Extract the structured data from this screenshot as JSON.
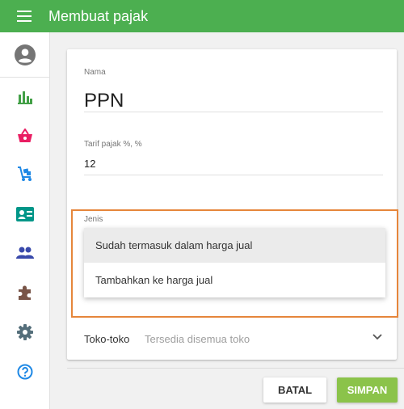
{
  "appbar": {
    "title": "Membuat pajak"
  },
  "form": {
    "name_label": "Nama",
    "name_value": "PPN",
    "rate_label": "Tarif pajak %, %",
    "rate_value": "12",
    "type_label": "Jenis",
    "type_options": [
      "Sudah termasuk dalam harga jual",
      "Tambahkan ke harga jual"
    ],
    "type_selected_index": 0,
    "stores_label": "Toko-toko",
    "stores_value": "Tersedia disemua toko"
  },
  "buttons": {
    "cancel": "BATAL",
    "save": "SIMPAN"
  },
  "colors": {
    "appbar": "#4caf50",
    "save_button": "#8bc34a",
    "highlight": "#e6863b",
    "nav_chart": "#43a047",
    "nav_basket": "#e91e63",
    "nav_cart": "#1e88e5",
    "nav_card": "#009688",
    "nav_people": "#3949ab",
    "nav_puzzle": "#795548",
    "nav_gear": "#546e7a",
    "nav_help": "#1e88e5"
  },
  "sidebar": {
    "icons": [
      "account-circle-icon",
      "bar-chart-icon",
      "basket-icon",
      "cart-icon",
      "id-card-icon",
      "people-icon",
      "puzzle-icon",
      "settings-icon",
      "help-icon"
    ]
  }
}
